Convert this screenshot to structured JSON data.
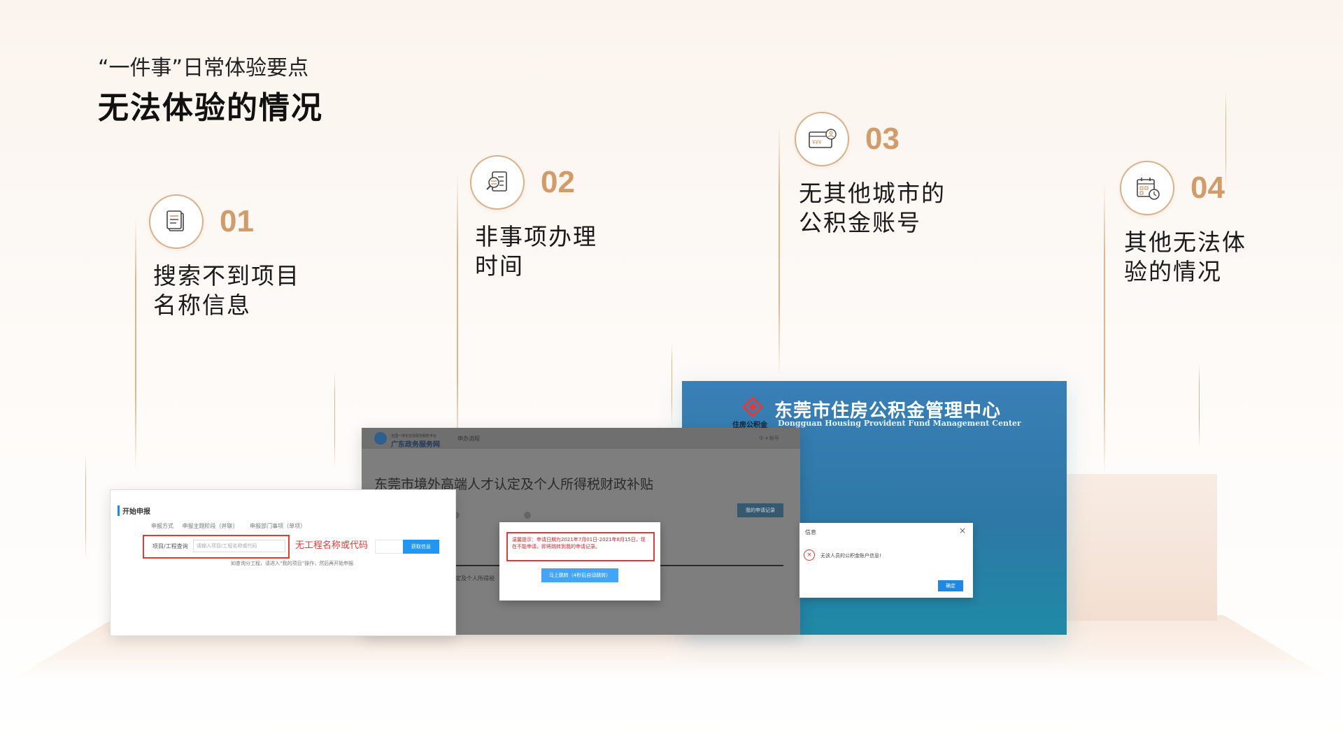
{
  "header": {
    "eyebrow": "“一件事”日常体验要点",
    "title": "无法体验的情况"
  },
  "steps": [
    {
      "num": "01",
      "label": "搜索不到项目\n名称信息",
      "icon": "document-icon"
    },
    {
      "num": "02",
      "label": "非事项办理\n时间",
      "icon": "search-document-icon"
    },
    {
      "num": "03",
      "label": "无其他城市的\n公积金账号",
      "icon": "card-account-icon"
    },
    {
      "num": "04",
      "label": "其他无法体\n验的情况",
      "icon": "calendar-clock-icon"
    }
  ],
  "shot1": {
    "section": "开始申报",
    "mode_label": "申报方式",
    "mode_opt1": "申报主题阶段（并联）",
    "mode_opt2": "申报部门事项（单项）",
    "field_label": "项目/工程查询",
    "field_placeholder": "请输入项目/工程名称或代码",
    "red_note": "无工程名称或代码",
    "button": "获取信息",
    "hint": "如查询分工程，请进入“我的项目”操作，然后再开始申报"
  },
  "shot2": {
    "brand_sub": "全国一体化在线政务服务平台",
    "brand": "广东政务服务网",
    "crumb": "申办流程",
    "user": "中 ▾ 帐号",
    "page_title": "东莞市境外高端人才认定及个人所得税财政补贴",
    "my_apps": "我的申请记录",
    "bg_text": "认定及个人所得税",
    "dialog_msg": "温馨提示：申请日期为2021年7月01日-2021年8月15日，现在不能申请。即将跳转到我的申请记录。",
    "dialog_button": "马上跳转（4秒后自动跳转）"
  },
  "shot3": {
    "title_cn": "东莞市住房公积金管理中心",
    "side_label": "住房公积金",
    "title_en": "Dongguan Housing Provident Fund Management Center",
    "dialog_header": "信息",
    "dialog_text": "无该人员的公积金账户信息!",
    "ok": "确定"
  }
}
